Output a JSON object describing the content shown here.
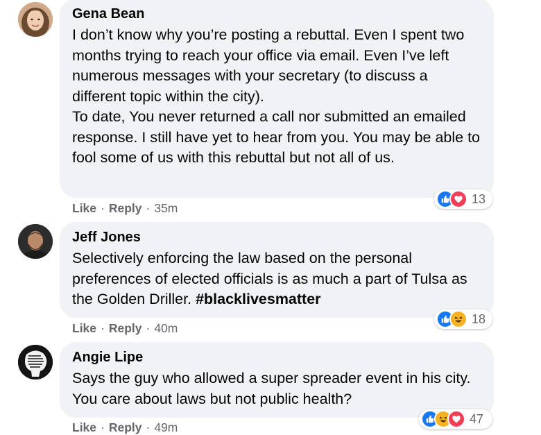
{
  "comments": [
    {
      "author": "Gena Bean",
      "text": "I don’t know why you’re posting a rebuttal. Even I spent two months trying to reach your office via email. Even I’ve left numerous messages with your secretary (to discuss a different topic within the city).\nTo date, You never returned a call nor submitted an emailed response. I still have yet to hear from you. You may be able to fool some of us with this rebuttal but not all of us.",
      "like_label": "Like",
      "reply_label": "Reply",
      "time": "35m",
      "reaction_icons": [
        "like-icon",
        "love-icon"
      ],
      "reaction_count": "13"
    },
    {
      "author": "Jeff Jones",
      "text": "Selectively enforcing the law based on the personal preferences of elected officials is as much a part of Tulsa as the Golden Driller. ",
      "hashtag": "#blacklivesmatter",
      "like_label": "Like",
      "reply_label": "Reply",
      "time": "40m",
      "reaction_icons": [
        "like-icon",
        "haha-icon"
      ],
      "reaction_count": "18"
    },
    {
      "author": "Angie Lipe",
      "text": "Says the guy who allowed a super spreader event in his city. You care about laws but not public health?",
      "like_label": "Like",
      "reply_label": "Reply",
      "time": "49m",
      "reaction_icons": [
        "like-icon",
        "haha-icon",
        "love-icon"
      ],
      "reaction_count": "47"
    }
  ],
  "separator": "·",
  "colors": {
    "bubble": "#f0f2f5",
    "meta_text": "#65676b",
    "like_blue": "#1877f2",
    "love_red": "#f33e58",
    "haha_yellow": "#f7b125"
  }
}
